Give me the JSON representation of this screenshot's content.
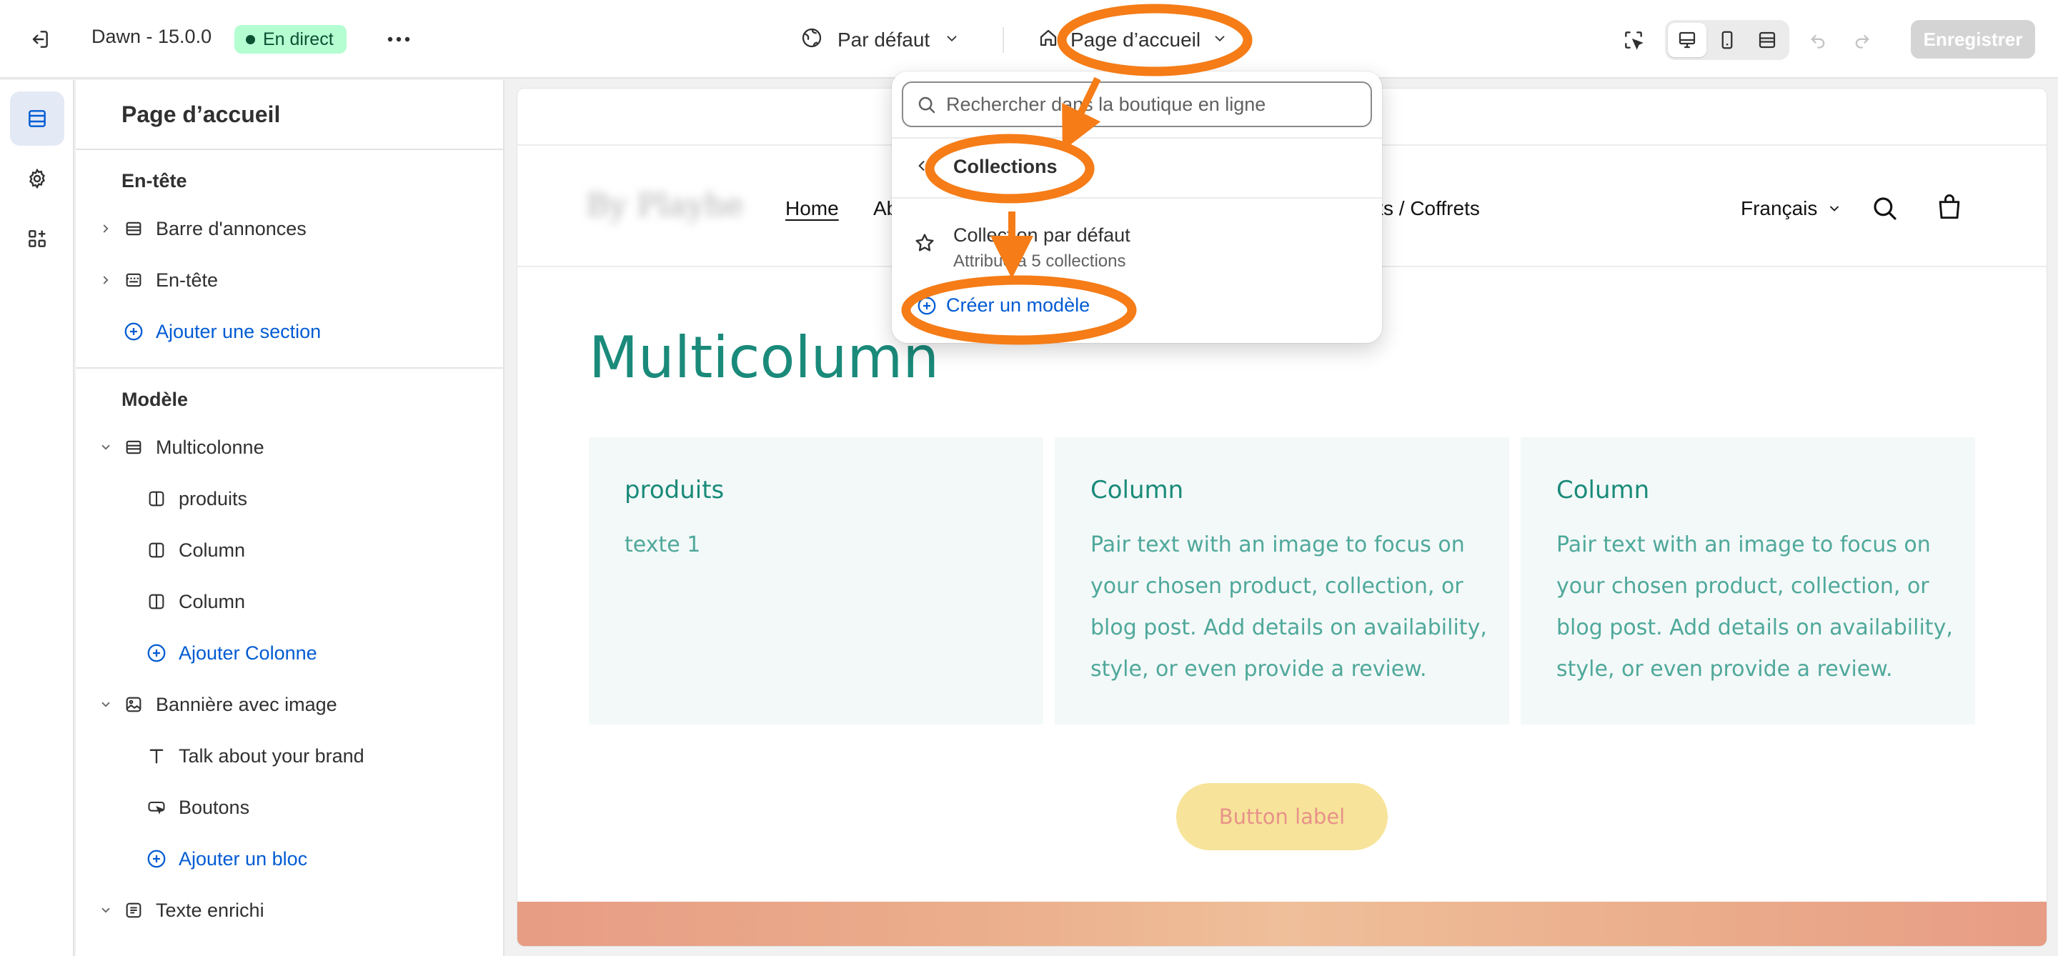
{
  "topbar": {
    "theme_name": "Dawn - 15.0.0",
    "live_badge": "En direct",
    "context_label": "Par défaut",
    "template_label": "Page d’accueil",
    "save_label": "Enregistrer"
  },
  "sidebar": {
    "title": "Page d’accueil",
    "header_group": "En-tête",
    "header_items": [
      {
        "label": "Barre d'annonces",
        "icon": "section-icon"
      },
      {
        "label": "En-tête",
        "icon": "header-section-icon"
      }
    ],
    "add_section_label": "Ajouter une section",
    "template_group": "Modèle",
    "multicolumn": {
      "label": "Multicolonne",
      "blocks": [
        "produits",
        "Column",
        "Column"
      ],
      "add_label": "Ajouter Colonne"
    },
    "banner": {
      "label": "Bannière avec image",
      "blocks": [
        {
          "label": "Talk about your brand",
          "icon": "text-icon"
        },
        {
          "label": "Boutons",
          "icon": "button-icon"
        }
      ],
      "add_label": "Ajouter un bloc"
    },
    "rich_text_label": "Texte enrichi"
  },
  "preview": {
    "logo_text": "By Playhe",
    "nav": {
      "home": "Home",
      "about": "Ab",
      "packs": "cks / Coffrets"
    },
    "language": "Français",
    "heading": "Multicolumn",
    "columns": [
      {
        "title": "produits",
        "text": "texte 1"
      },
      {
        "title": "Column",
        "text": "Pair text with an image to focus on your chosen product, collection, or blog post. Add details on availability, style, or even provide a review."
      },
      {
        "title": "Column",
        "text": "Pair text with an image to focus on your chosen product, collection, or blog post. Add details on availability, style, or even provide a review."
      }
    ],
    "button_label": "Button label"
  },
  "dropdown": {
    "search_placeholder": "Rechercher dans la boutique en ligne",
    "heading": "Collections",
    "item_title": "Collection par défaut",
    "item_subtitle": "Attribué à 5 collections",
    "create_label": "Créer un modèle"
  },
  "colors": {
    "accent_blue": "#005bd3",
    "live_badge_bg": "#b4fed2",
    "annotation_orange": "#f57c17",
    "preview_heading": "#1a8a7a",
    "preview_button_bg": "#f7e49a"
  }
}
